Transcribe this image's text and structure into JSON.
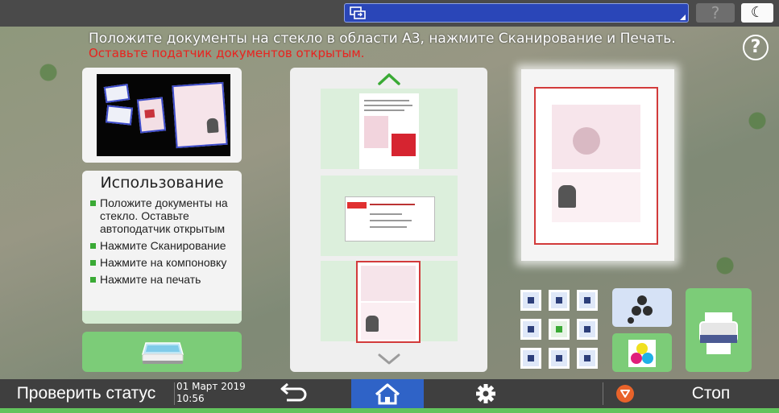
{
  "header": {
    "help_glyph": "?",
    "moon_glyph": "☾"
  },
  "instructions": {
    "line1": "Положите документы на стекло в области А3, нажмите Сканирование и Печать.",
    "line2": "Оставьте податчик документов открытым.",
    "help_glyph": "?"
  },
  "usage": {
    "title": "Использование",
    "items": [
      "Положите документы на стекло. Оставьте автоподатчик открытым",
      "Нажмите Сканирование",
      "Нажмите на компоновку",
      "Нажмите на печать"
    ]
  },
  "footer": {
    "status_label": "Проверить статус",
    "date": "01 Март 2019",
    "time": "10:56",
    "stop_label": "Стоп"
  },
  "icons": {
    "top_input": "screen-copy-icon",
    "help": "question-circle-icon",
    "theme": "moon-icon",
    "scan": "scanner-icon",
    "mono": "mono-toner-icon",
    "color": "color-toner-icon",
    "print": "printer-icon",
    "back": "back-arrow-icon",
    "home": "home-icon",
    "settings": "gear-icon",
    "stop": "stop-icon"
  },
  "colors": {
    "accent_green": "#7ccc78",
    "home_blue": "#2f63c7",
    "warning_red": "#e8231f",
    "topbar_field": "#2a46b8"
  }
}
